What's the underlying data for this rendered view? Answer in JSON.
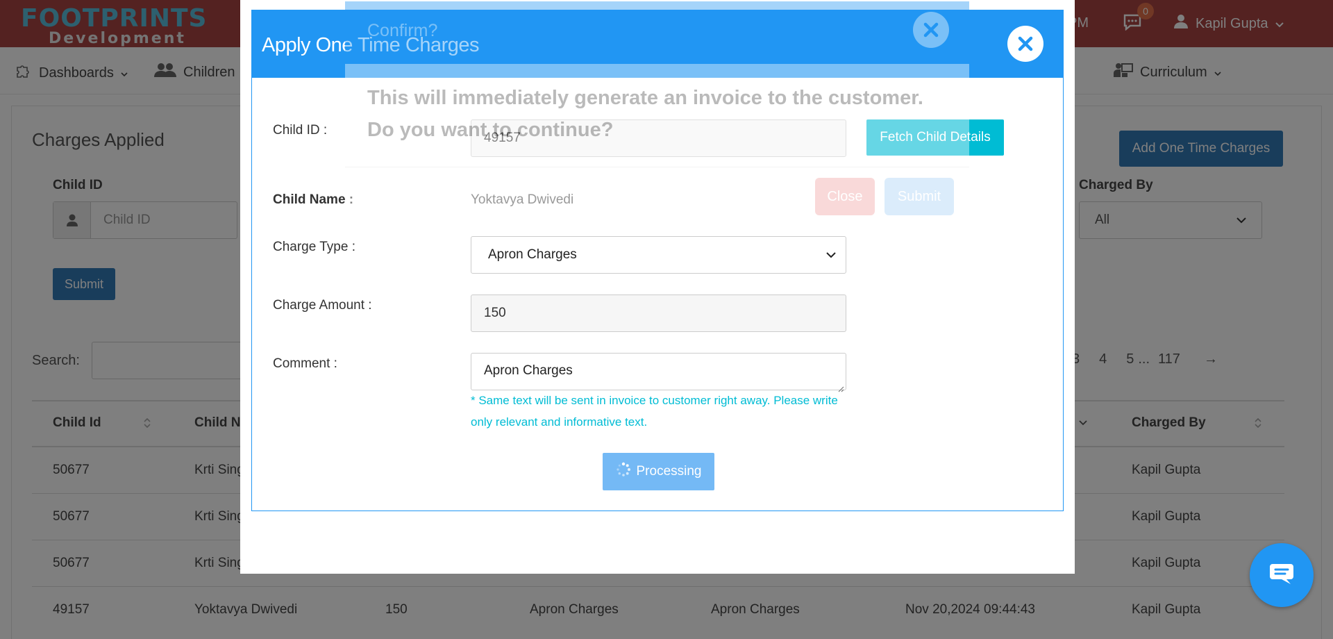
{
  "header": {
    "brand_main": "FOOTPRINTS",
    "brand_sub": "Development",
    "time_fragment": "PM",
    "chat_badge": "0",
    "user_name": "Kapil Gupta"
  },
  "nav": {
    "items": [
      {
        "label": "Dashboards",
        "icon": "puzzle-icon"
      },
      {
        "label": "Children",
        "icon": "users-icon"
      },
      {
        "label": "Curriculum",
        "icon": "teacher-icon"
      }
    ]
  },
  "page": {
    "title": "Charges Applied",
    "add_button": "Add One Time Charges",
    "filters": {
      "child_id_label": "Child ID",
      "child_id_placeholder": "Child ID",
      "charged_by_label": "Charged By",
      "charged_by_value": "All"
    },
    "submit_label": "Submit",
    "search_label": "Search:",
    "pagination": {
      "pages": [
        "3",
        "4",
        "5"
      ],
      "ellipsis": "...",
      "last": "117",
      "next": "→"
    },
    "table": {
      "headers": {
        "child_id": "Child Id",
        "child_name": "Child Na",
        "charged_by": "Charged By"
      },
      "rows": [
        {
          "child_id": "50677",
          "name": "Krti Sing",
          "amount": "",
          "type": "",
          "comment": "",
          "date": "",
          "charged_by": "Kapil Gupta"
        },
        {
          "child_id": "50677",
          "name": "Krti Sing",
          "amount": "",
          "type": "",
          "comment": "",
          "date": "",
          "charged_by": "Kapil Gupta"
        },
        {
          "child_id": "50677",
          "name": "Krti Sing",
          "amount": "",
          "type": "",
          "comment": "",
          "date": "",
          "charged_by": "Kapil Gupta"
        },
        {
          "child_id": "49157",
          "name": "Yoktavya Dwivedi",
          "amount": "150",
          "type": "Apron Charges",
          "comment": "Apron Charges",
          "date": "Nov 20,2024 09:44:43",
          "charged_by": "Kapil Gupta"
        }
      ]
    }
  },
  "modal": {
    "title": "Apply One Time Charges",
    "child_id_label": "Child ID :",
    "child_id_value": "49157",
    "fetch_button": "Fetch Child Details",
    "child_name_label": "Child Name :",
    "child_name_value": "Yoktavya Dwivedi",
    "charge_type_label": "Charge Type :",
    "charge_type_value": "Apron Charges",
    "charge_amount_label": "Charge Amount :",
    "charge_amount_value": "150",
    "comment_label": "Comment :",
    "comment_value": "Apron Charges",
    "hint_text": "* Same text will be sent in invoice to customer right away. Please write only relevant and informative text.",
    "processing_label": "Processing"
  },
  "confirm": {
    "title": "Confirm?",
    "message": "This will immediately generate an invoice to the customer. Do you want to continue?",
    "close_label": "Close",
    "submit_label": "Submit"
  },
  "colors": {
    "topbar": "#a94442",
    "primary": "#2196f3",
    "info": "#00bcd4",
    "danger_light": "#f2a3a3"
  }
}
